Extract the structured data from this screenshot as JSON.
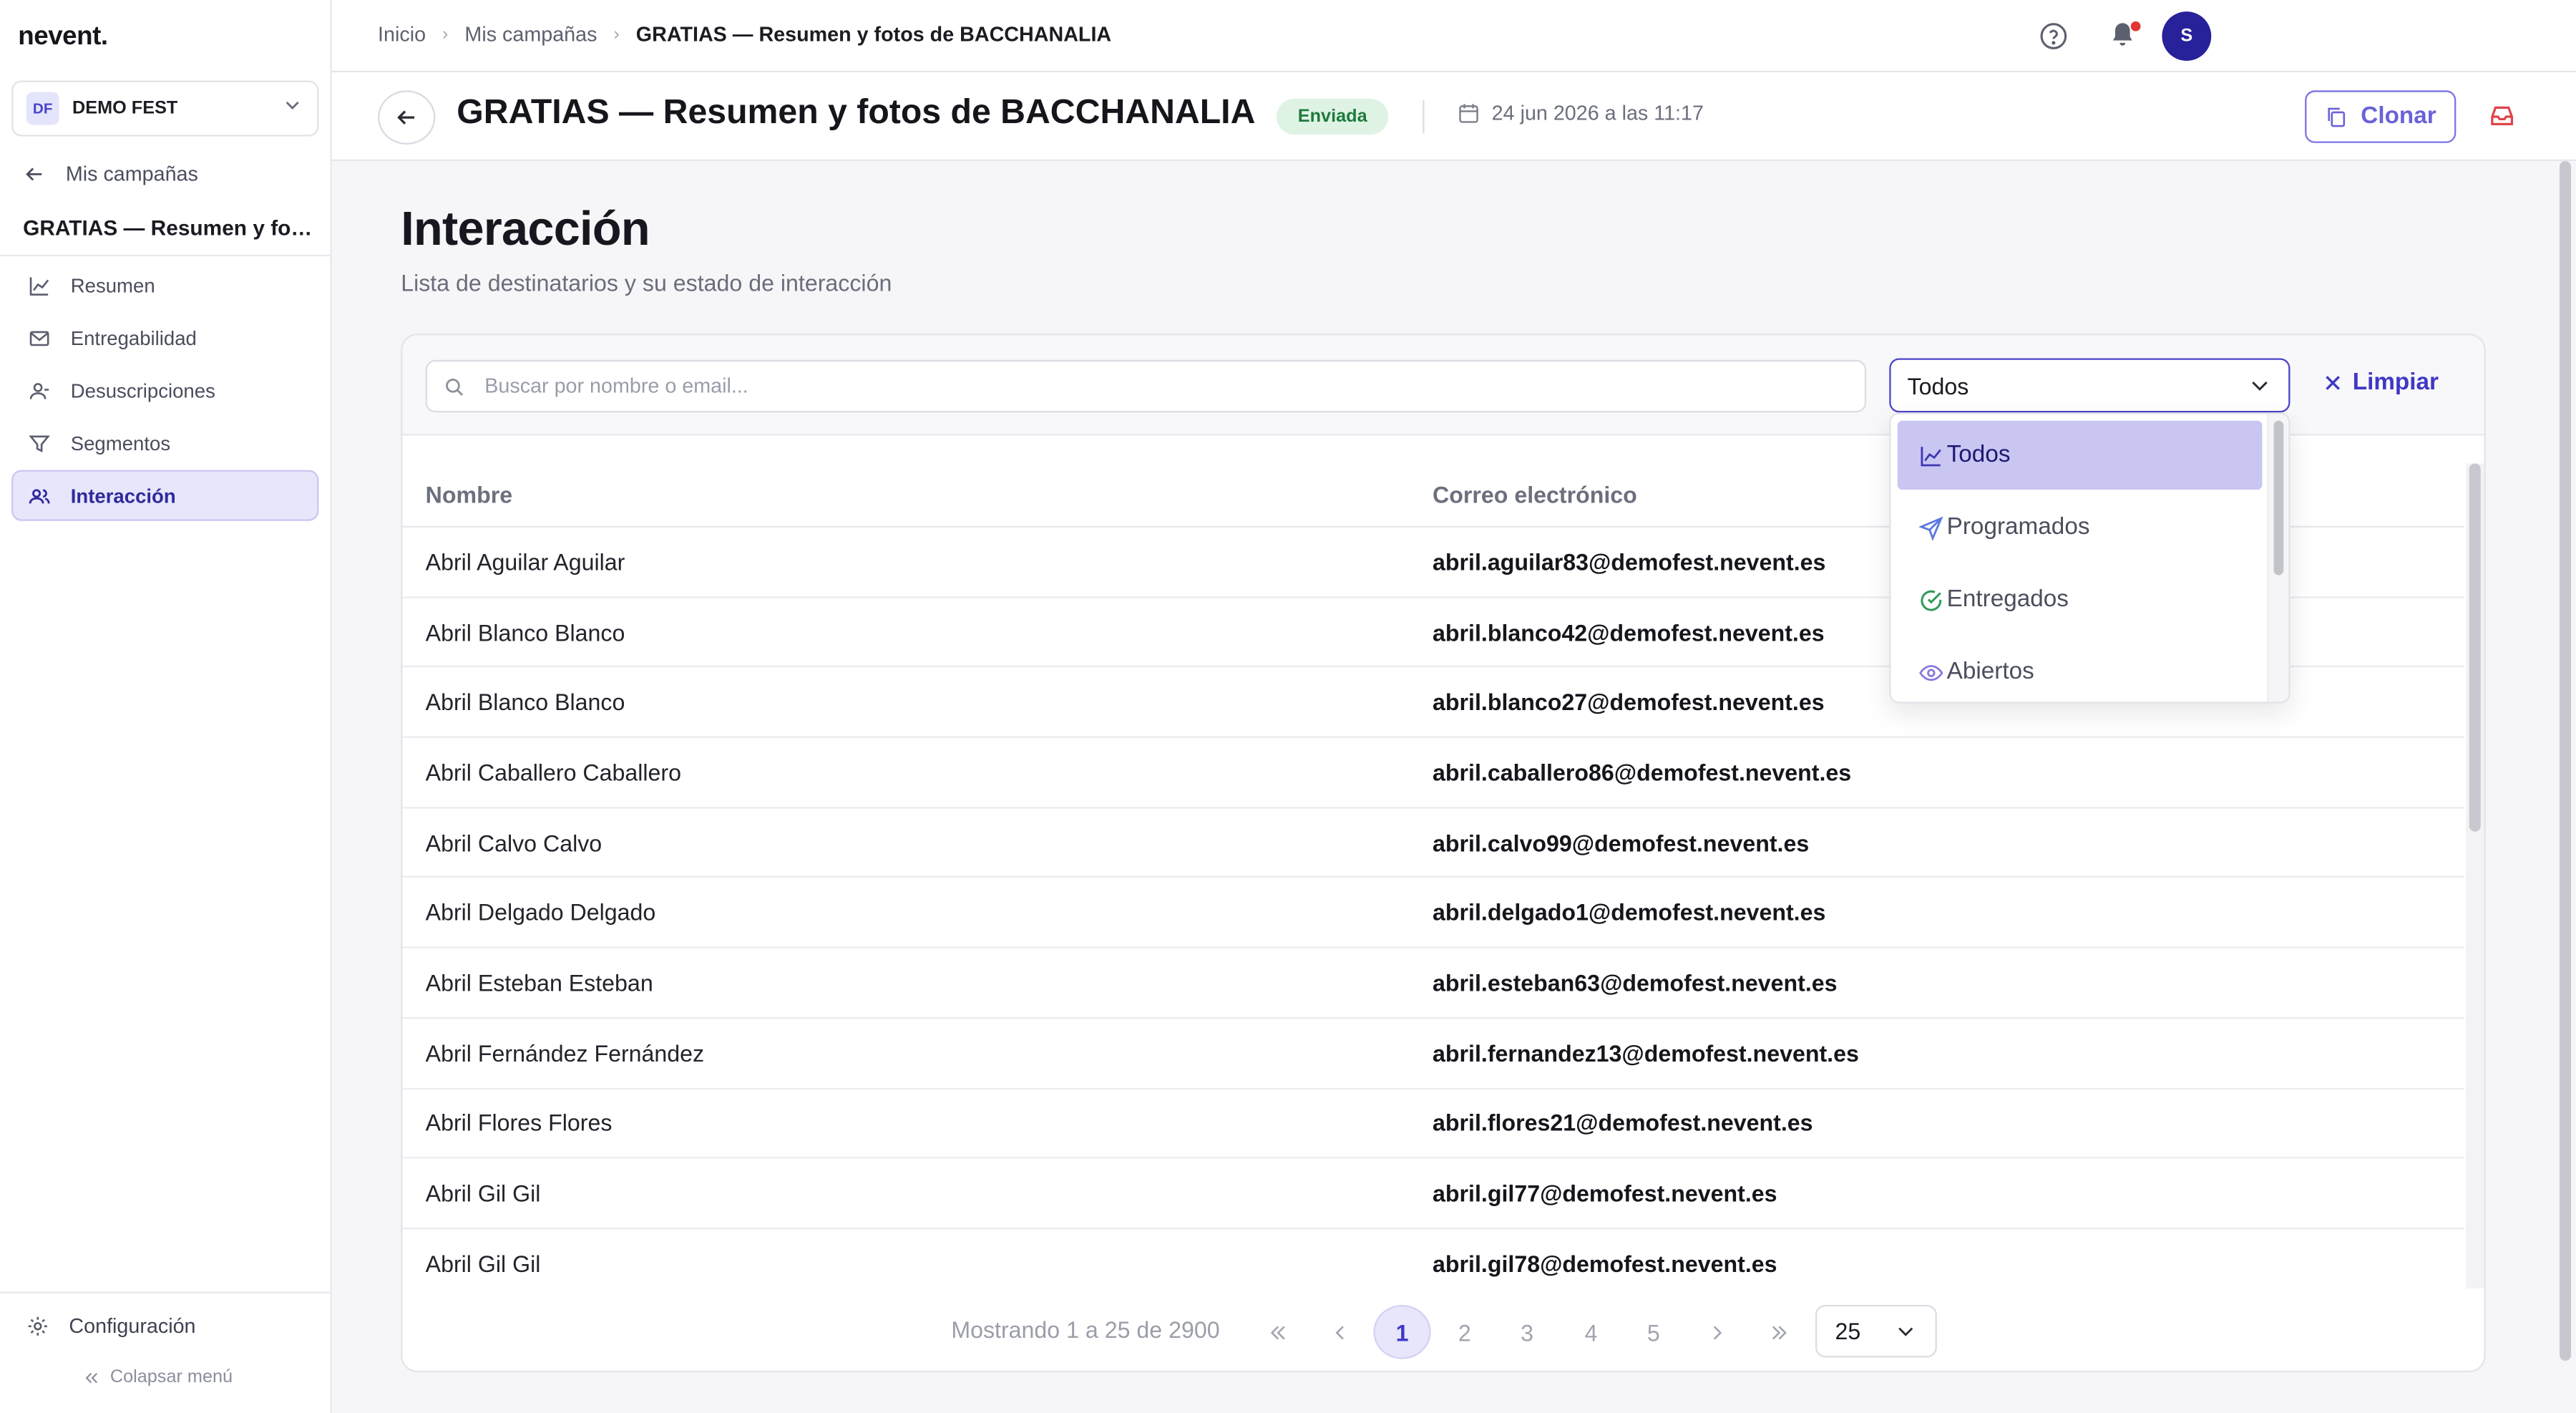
{
  "app": {
    "logo": "nevent.",
    "org": {
      "initials": "DF",
      "name": "DEMO FEST"
    }
  },
  "sidebar": {
    "back_label": "Mis campañas",
    "campaign_title": "GRATIAS — Resumen y fotos de BACCHANALIA",
    "items": [
      {
        "label": "Resumen",
        "icon": "chart-line-icon"
      },
      {
        "label": "Entregabilidad",
        "icon": "mail-icon"
      },
      {
        "label": "Desuscripciones",
        "icon": "user-minus-icon"
      },
      {
        "label": "Segmentos",
        "icon": "filter-icon"
      },
      {
        "label": "Interacción",
        "icon": "users-icon",
        "active": true
      }
    ],
    "config_label": "Configuración",
    "collapse_label": "Colapsar menú"
  },
  "topbar": {
    "breadcrumbs": [
      "Inicio",
      "Mis campañas",
      "GRATIAS — Resumen y fotos de BACCHANALIA"
    ],
    "avatar_initial": "S"
  },
  "header": {
    "title": "GRATIAS — Resumen y fotos de BACCHANALIA",
    "status": "Enviada",
    "date": "24 jun 2026 a las 11:17",
    "clone_label": "Clonar"
  },
  "main": {
    "heading": "Interacción",
    "subheading": "Lista de destinatarios y su estado de interacción",
    "search_placeholder": "Buscar por nombre o email...",
    "filter_selected": "Todos",
    "clear_label": "Limpiar",
    "filter_options": [
      {
        "label": "Todos",
        "icon": "chart-line-icon"
      },
      {
        "label": "Programados",
        "icon": "send-icon"
      },
      {
        "label": "Entregados",
        "icon": "check-circle-icon"
      },
      {
        "label": "Abiertos",
        "icon": "eye-icon"
      }
    ],
    "columns": [
      "Nombre",
      "Correo electrónico"
    ],
    "rows": [
      {
        "name": "Abril Aguilar Aguilar",
        "email": "abril.aguilar83@demofest.nevent.es"
      },
      {
        "name": "Abril Blanco Blanco",
        "email": "abril.blanco42@demofest.nevent.es"
      },
      {
        "name": "Abril Blanco Blanco",
        "email": "abril.blanco27@demofest.nevent.es"
      },
      {
        "name": "Abril Caballero Caballero",
        "email": "abril.caballero86@demofest.nevent.es"
      },
      {
        "name": "Abril Calvo Calvo",
        "email": "abril.calvo99@demofest.nevent.es"
      },
      {
        "name": "Abril Delgado Delgado",
        "email": "abril.delgado1@demofest.nevent.es"
      },
      {
        "name": "Abril Esteban Esteban",
        "email": "abril.esteban63@demofest.nevent.es"
      },
      {
        "name": "Abril Fernández Fernández",
        "email": "abril.fernandez13@demofest.nevent.es"
      },
      {
        "name": "Abril Flores Flores",
        "email": "abril.flores21@demofest.nevent.es"
      },
      {
        "name": "Abril Gil Gil",
        "email": "abril.gil77@demofest.nevent.es"
      },
      {
        "name": "Abril Gil Gil",
        "email": "abril.gil78@demofest.nevent.es"
      }
    ],
    "pagination": {
      "info": "Mostrando 1 a 25 de 2900",
      "pages": [
        "1",
        "2",
        "3",
        "4",
        "5"
      ],
      "current": "1",
      "per_page": "25"
    }
  },
  "colors": {
    "accent": "#4b44c9",
    "accent_soft": "#e7e6fb",
    "status_sent_bg": "#dff3e4",
    "status_sent_text": "#1f7a3d",
    "notification": "#e23636"
  }
}
